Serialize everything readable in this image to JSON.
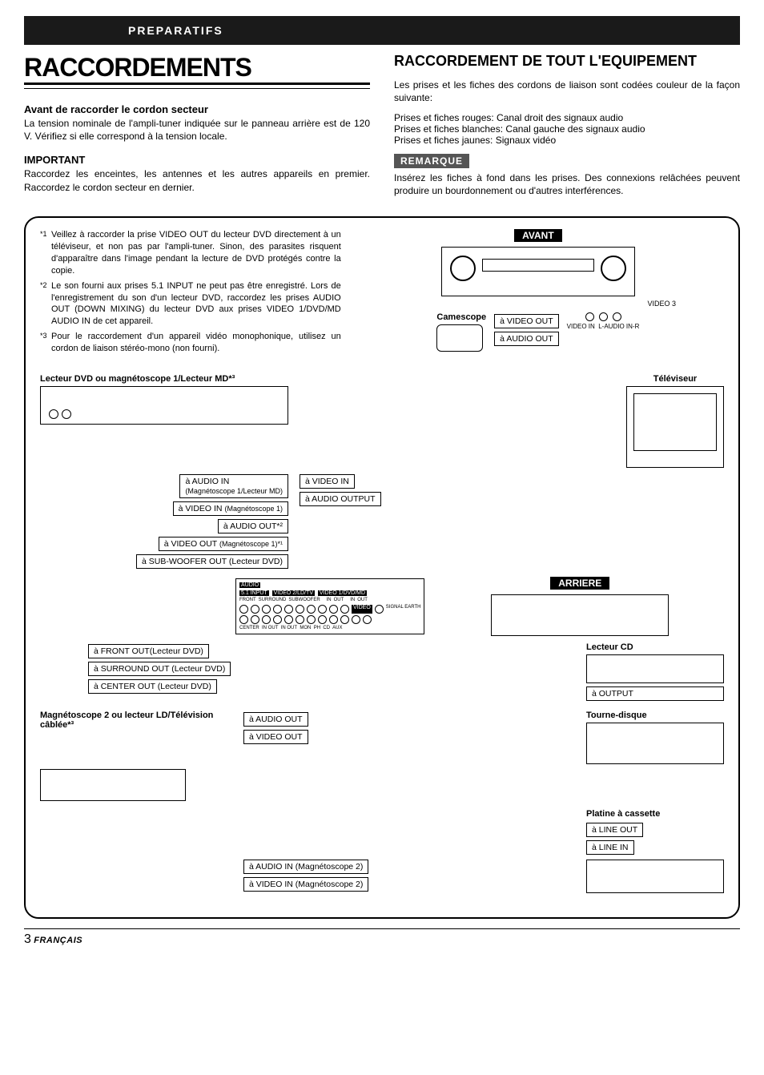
{
  "header_band": "PREPARATIFS",
  "left": {
    "title": "RACCORDEMENTS",
    "sub1_head": "Avant de raccorder le cordon secteur",
    "sub1_body": "La tension nominale de l'ampli-tuner indiquée sur le panneau arrière est de 120 V. Vérifiez si elle correspond à la tension locale.",
    "sub2_head": "IMPORTANT",
    "sub2_body": "Raccordez les enceintes, les antennes et les autres appareils en premier. Raccordez le cordon secteur en dernier."
  },
  "right": {
    "title": "RACCORDEMENT DE TOUT L'EQUIPEMENT",
    "intro": "Les prises et les fiches des cordons de liaison sont codées couleur de la façon suivante:",
    "line1": "Prises et fiches rouges: Canal droit des signaux audio",
    "line2": "Prises et fiches blanches: Canal gauche des signaux audio",
    "line3": "Prises et fiches jaunes: Signaux vidéo",
    "note_badge": "REMARQUE",
    "note_body": "Insérez les fiches à fond dans les prises. Des connexions relâchées peuvent produire un bourdonnement ou d'autres interférences."
  },
  "footnotes": {
    "f1": "Veillez à raccorder la prise VIDEO OUT du lecteur DVD directement à un téléviseur, et non pas par l'ampli-tuner. Sinon, des parasites risquent d'apparaître dans l'image pendant la lecture de DVD protégés contre la copie.",
    "f2": "Le son fourni aux prises 5.1 INPUT ne peut pas être enregistré. Lors de l'enregistrement du son d'un lecteur DVD, raccordez les prises AUDIO OUT (DOWN MIXING) du lecteur DVD aux prises VIDEO 1/DVD/MD AUDIO IN de cet appareil.",
    "f3": "Pour le raccordement d'un appareil vidéo monophonique, utilisez un cordon de liaison stéréo-mono (non fourni)."
  },
  "diagram": {
    "avant_label": "AVANT",
    "arriere_label": "ARRIERE",
    "camescope": "Camescope",
    "video3": "VIDEO 3",
    "video_in_jack": "VIDEO IN",
    "laudio_in_r": "L-AUDIO IN-R",
    "to_video_out": "à VIDEO OUT",
    "to_audio_out": "à AUDIO OUT",
    "dvd_title": "Lecteur DVD ou magnétoscope 1/Lecteur MD*³",
    "televiseur": "Téléviseur",
    "to_video_in": "à VIDEO IN",
    "to_audio_output": "à AUDIO OUTPUT",
    "c_audio_in": "à AUDIO IN",
    "c_audio_in_sub": "(Magnétoscope 1/Lecteur MD)",
    "c_video_in": "à VIDEO IN",
    "c_video_in_sub": "(Magnétoscope 1)",
    "c_audio_out": "à AUDIO OUT*²",
    "c_video_out": "à VIDEO OUT",
    "c_video_out_sub": "(Magnétoscope 1)*¹",
    "c_subwoofer": "à SUB-WOOFER OUT (Lecteur DVD)",
    "c_front_out": "à FRONT OUT(Lecteur DVD)",
    "c_surround_out": "à SURROUND OUT (Lecteur DVD)",
    "c_center_out": "à CENTER OUT (Lecteur DVD)",
    "vcr2_title": "Magnétoscope 2 ou lecteur LD/Télévision câblée*³",
    "vcr2_audio_out": "à AUDIO OUT",
    "vcr2_video_out": "à VIDEO OUT",
    "vcr2_audio_in": "à AUDIO IN (Magnétoscope 2)",
    "vcr2_video_in": "à VIDEO IN (Magnétoscope 2)",
    "cd_title": "Lecteur CD",
    "to_output": "à OUTPUT",
    "turntable_title": "Tourne-disque",
    "cassette_title": "Platine à cassette",
    "to_line_out": "à LINE OUT",
    "to_line_in": "à LINE IN",
    "panel_audio": "AUDIO",
    "panel_51": "5.1 INPUT",
    "panel_front": "FRONT",
    "panel_surround": "SURROUND",
    "panel_subwoofer": "SUBWOOFER",
    "panel_center": "CENTER",
    "panel_in": "IN",
    "panel_out": "OUT",
    "panel_video2": "VIDEO 2/LD/TV",
    "panel_video1": "VIDEO 1/DVD/MD",
    "panel_video": "VIDEO",
    "panel_mon": "MON",
    "panel_ph": "PH",
    "panel_cd": "CD",
    "panel_aux": "AUX",
    "panel_signal_earth": "SIGNAL EARTH"
  },
  "footer": {
    "page": "3",
    "lang": "FRANÇAIS"
  }
}
